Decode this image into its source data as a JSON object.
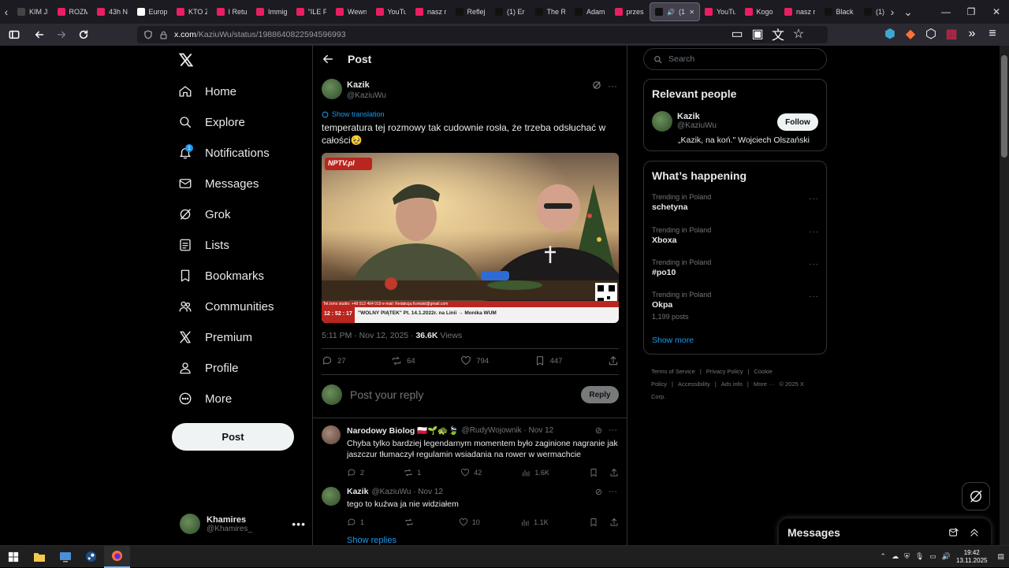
{
  "browser": {
    "tabs": [
      {
        "title": "KIM JI",
        "fav": "#444",
        "active": false
      },
      {
        "title": "ROZM",
        "fav": "#e91e63",
        "active": false
      },
      {
        "title": "43h N",
        "fav": "#e91e63",
        "active": false
      },
      {
        "title": "Europ",
        "fav": "#ffffff",
        "active": false
      },
      {
        "title": "KTO Z",
        "fav": "#e91e63",
        "active": false
      },
      {
        "title": "I Retu",
        "fav": "#e91e63",
        "active": false
      },
      {
        "title": "Immig",
        "fav": "#e91e63",
        "active": false
      },
      {
        "title": "\"ILE P",
        "fav": "#e91e63",
        "active": false
      },
      {
        "title": "Wewn",
        "fav": "#e91e63",
        "active": false
      },
      {
        "title": "YouTu",
        "fav": "#e91e63",
        "active": false
      },
      {
        "title": "nasz r",
        "fav": "#e91e63",
        "active": false
      },
      {
        "title": "Reflej",
        "fav": "#111111",
        "active": false
      },
      {
        "title": "(1) Er",
        "fav": "#111111",
        "active": false
      },
      {
        "title": "The R",
        "fav": "#111111",
        "active": false
      },
      {
        "title": "Adam",
        "fav": "#111111",
        "active": false
      },
      {
        "title": "przes",
        "fav": "#e91e63",
        "active": false
      },
      {
        "title": "(1)",
        "fav": "#111111",
        "active": true
      },
      {
        "title": "YouTu",
        "fav": "#e91e63",
        "active": false
      },
      {
        "title": "Kogo",
        "fav": "#e91e63",
        "active": false
      },
      {
        "title": "nasz r",
        "fav": "#e91e63",
        "active": false
      },
      {
        "title": "Black",
        "fav": "#111111",
        "active": false
      },
      {
        "title": "(1) E",
        "fav": "#111111",
        "active": false
      }
    ],
    "url_host": "x.com",
    "url_path": "/KaziuWu/status/1988640822594596993"
  },
  "nav": {
    "items": [
      {
        "label": "Home",
        "icon": "home-icon"
      },
      {
        "label": "Explore",
        "icon": "search-icon"
      },
      {
        "label": "Notifications",
        "icon": "bell-icon"
      },
      {
        "label": "Messages",
        "icon": "mail-icon"
      },
      {
        "label": "Grok",
        "icon": "grok-icon"
      },
      {
        "label": "Lists",
        "icon": "list-icon"
      },
      {
        "label": "Bookmarks",
        "icon": "bookmark-icon"
      },
      {
        "label": "Communities",
        "icon": "communities-icon"
      },
      {
        "label": "Premium",
        "icon": "x-logo-icon"
      },
      {
        "label": "Profile",
        "icon": "person-icon"
      },
      {
        "label": "More",
        "icon": "more-circle-icon"
      }
    ],
    "notification_badge": "1",
    "post_button": "Post",
    "account_name": "Khamires",
    "account_handle": "@Khamires_"
  },
  "main": {
    "header_title": "Post",
    "author_name": "Kazik",
    "author_handle": "@KaziuWu",
    "show_translation": "Show translation",
    "text": "temperatura tej rozmowy tak cudownie rosła, że trzeba odsłuchać w całości🥹",
    "media": {
      "logo": "NPTV.pl",
      "ticker_top": "Tel./sms studio: +48 512 464 019 e-mail: Redakcja.Kontakt@gmail.com",
      "clock": "12 : 52 : 17",
      "ticker_bottom": "\"WOLNY PIĄTEK\" Pt. 14.1.2022r. na Linii → Monika WUM"
    },
    "timestamp": "5:11 PM · Nov 12, 2025 · ",
    "views_count": "36.6K",
    "views_label": " Views",
    "stats": {
      "replies": "27",
      "reposts": "64",
      "likes": "794",
      "bookmarks": "447"
    },
    "reply_placeholder": "Post your reply",
    "reply_button": "Reply",
    "comments": [
      {
        "name": "Narodowy Biolog 🇵🇱🌱🐢🍃",
        "handle": "@RudyWojownik · Nov 12",
        "text": "Chyba tylko bardziej legendarnym momentem było zaginione nagranie jak jaszczur tłumaczył regulamin wsiadania na rower w wermachcie",
        "replies": "2",
        "reposts": "1",
        "likes": "42",
        "views": "1.6K"
      },
      {
        "name": "Kazik",
        "handle": "@KaziuWu · Nov 12",
        "text": "tego to kuźwa ja nie widziałem",
        "replies": "1",
        "reposts": "",
        "likes": "10",
        "views": "1.1K"
      }
    ],
    "show_replies": "Show replies"
  },
  "right": {
    "search_placeholder": "Search",
    "relevant_title": "Relevant people",
    "person_name": "Kazik",
    "person_handle": "@KaziuWu",
    "person_bio": "„Kazik, na koń.\" Wojciech Olszański",
    "follow_label": "Follow",
    "happening_title": "What’s happening",
    "trends": [
      {
        "kicker": "Trending in Poland",
        "topic": "schetyna",
        "posts": ""
      },
      {
        "kicker": "Trending in Poland",
        "topic": "Xboxa",
        "posts": ""
      },
      {
        "kicker": "Trending in Poland",
        "topic": "#po10",
        "posts": ""
      },
      {
        "kicker": "Trending in Poland",
        "topic": "Okpa",
        "posts": "1,199 posts"
      }
    ],
    "show_more": "Show more",
    "footer_links": [
      "Terms of Service",
      "|",
      "Privacy Policy",
      "|",
      "Cookie Policy",
      "|",
      "Accessibility",
      "|",
      "Ads info",
      "|",
      "More ···",
      "© 2025 X Corp."
    ]
  },
  "messages_drawer": {
    "title": "Messages"
  },
  "taskbar": {
    "time": "19:42",
    "date": "13.11.2025"
  },
  "colors": {
    "accent": "#1d9bf0",
    "background": "#000000",
    "border": "#2f3336",
    "muted": "#71767b"
  }
}
